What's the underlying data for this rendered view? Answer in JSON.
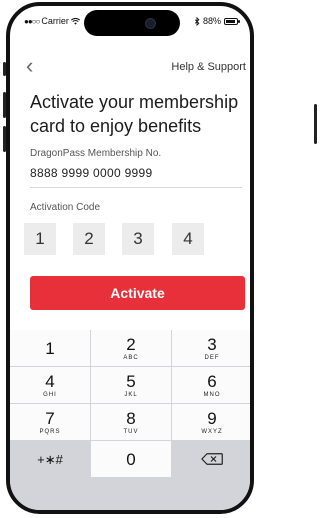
{
  "status_bar": {
    "carrier_dots": "●●○○",
    "carrier": "Carrier",
    "wifi_icon": "wifi-icon",
    "bluetooth_icon": "bluetooth-icon",
    "battery": "88%",
    "battery_icon": "battery-icon"
  },
  "nav": {
    "back_icon": "‹",
    "help_label": "Help & Support"
  },
  "title": "Activate your membership card to enjoy benefits",
  "membership": {
    "label": "DragonPass Membership No.",
    "value": "8888 9999 0000 9999"
  },
  "activation": {
    "label": "Activation Code",
    "digits": [
      "1",
      "2",
      "3",
      "4"
    ]
  },
  "activate_button": "Activate",
  "keypad": {
    "keys": [
      {
        "num": "1",
        "letters": ""
      },
      {
        "num": "2",
        "letters": "ABC"
      },
      {
        "num": "3",
        "letters": "DEF"
      },
      {
        "num": "4",
        "letters": "GHI"
      },
      {
        "num": "5",
        "letters": "JKL"
      },
      {
        "num": "6",
        "letters": "MNO"
      },
      {
        "num": "7",
        "letters": "PQRS"
      },
      {
        "num": "8",
        "letters": "TUV"
      },
      {
        "num": "9",
        "letters": "WXYZ"
      },
      {
        "num": "+∗#",
        "letters": ""
      },
      {
        "num": "0",
        "letters": ""
      }
    ],
    "backspace_icon": "backspace-icon"
  },
  "colors": {
    "accent": "#e8303a",
    "keypad_bg": "#d2d4d9",
    "code_box_bg": "#ececec"
  }
}
